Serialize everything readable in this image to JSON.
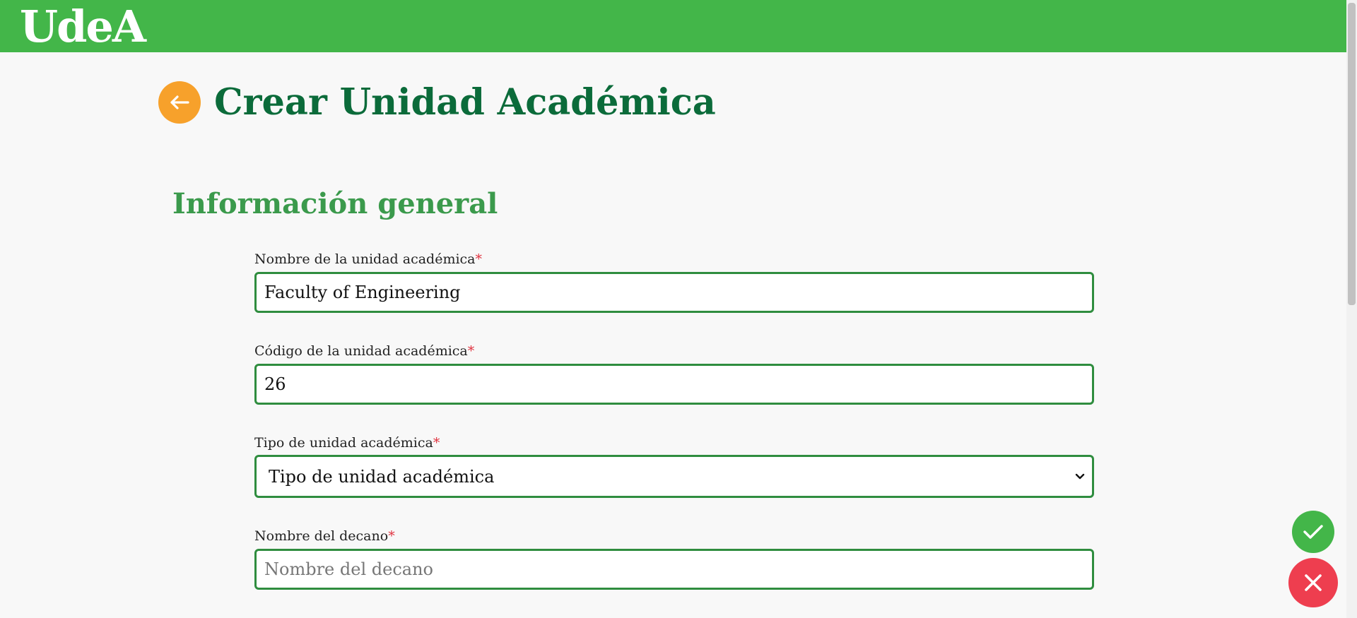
{
  "header": {
    "logo_text": "UdeA",
    "brand_color": "#43b649"
  },
  "page": {
    "title": "Crear Unidad Académica",
    "back_icon": "arrow-left-icon"
  },
  "section": {
    "title": "Información general"
  },
  "form": {
    "required_mark": "*",
    "nombre": {
      "label": "Nombre de la unidad académica",
      "value": "Faculty of Engineering",
      "placeholder": "Nombre de la unidad académica"
    },
    "codigo": {
      "label": "Código de la unidad académica",
      "value": "26",
      "placeholder": "Código de la unidad académica"
    },
    "tipo": {
      "label": "Tipo de unidad académica",
      "selected": "Tipo de unidad académica"
    },
    "decano": {
      "label": "Nombre del decano",
      "value": "",
      "placeholder": "Nombre del decano"
    }
  },
  "actions": {
    "confirm_icon": "check-icon",
    "cancel_icon": "close-icon",
    "confirm_color": "#43b649",
    "cancel_color": "#ee3e4f"
  }
}
